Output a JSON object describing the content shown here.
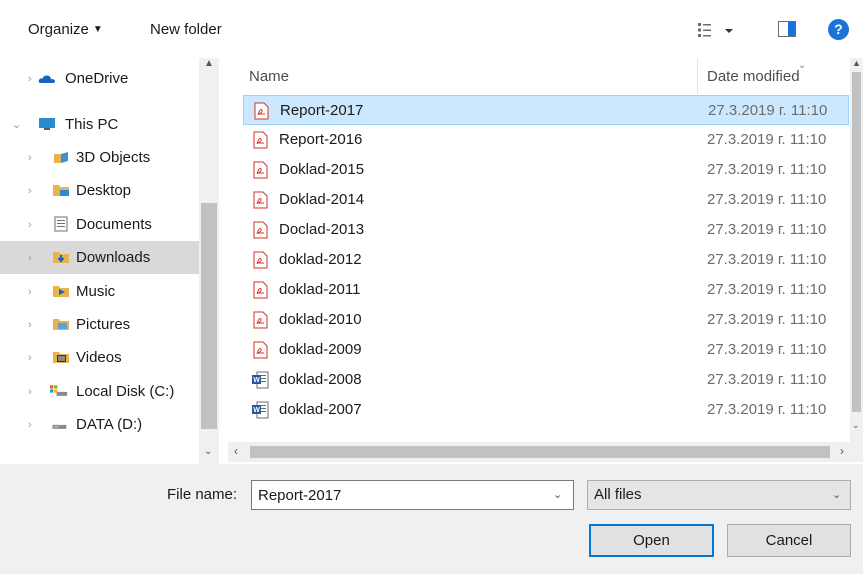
{
  "toolbar": {
    "organize_label": "Organize",
    "new_folder_label": "New folder",
    "help_label": "?"
  },
  "nav": {
    "items": [
      {
        "label": "OneDrive",
        "icon": "onedrive-icon"
      },
      {
        "label": "This PC",
        "icon": "pc-icon"
      },
      {
        "label": "3D Objects",
        "icon": "3d-objects-icon"
      },
      {
        "label": "Desktop",
        "icon": "desktop-icon"
      },
      {
        "label": "Documents",
        "icon": "documents-icon"
      },
      {
        "label": "Downloads",
        "icon": "downloads-icon"
      },
      {
        "label": "Music",
        "icon": "music-icon"
      },
      {
        "label": "Pictures",
        "icon": "pictures-icon"
      },
      {
        "label": "Videos",
        "icon": "videos-icon"
      },
      {
        "label": "Local Disk (C:)",
        "icon": "local-disk-icon"
      },
      {
        "label": "DATA (D:)",
        "icon": "drive-icon"
      }
    ],
    "selected": "Downloads"
  },
  "list": {
    "columns": {
      "name": "Name",
      "date": "Date modified"
    },
    "rows": [
      {
        "name": "Report-2017",
        "date": "27.3.2019 г. 11:10",
        "type": "pdf"
      },
      {
        "name": "Report-2016",
        "date": "27.3.2019 г. 11:10",
        "type": "pdf"
      },
      {
        "name": "Doklad-2015",
        "date": "27.3.2019 г. 11:10",
        "type": "pdf"
      },
      {
        "name": "Doklad-2014",
        "date": "27.3.2019 г. 11:10",
        "type": "pdf"
      },
      {
        "name": "Doclad-2013",
        "date": "27.3.2019 г. 11:10",
        "type": "pdf"
      },
      {
        "name": "doklad-2012",
        "date": "27.3.2019 г. 11:10",
        "type": "pdf"
      },
      {
        "name": "doklad-2011",
        "date": "27.3.2019 г. 11:10",
        "type": "pdf"
      },
      {
        "name": "doklad-2010",
        "date": "27.3.2019 г. 11:10",
        "type": "pdf"
      },
      {
        "name": "doklad-2009",
        "date": "27.3.2019 г. 11:10",
        "type": "pdf"
      },
      {
        "name": "doklad-2008",
        "date": "27.3.2019 г. 11:10",
        "type": "word"
      },
      {
        "name": "doklad-2007",
        "date": "27.3.2019 г. 11:10",
        "type": "word"
      }
    ],
    "selected": "Report-2017"
  },
  "bottom": {
    "file_name_label": "File name:",
    "file_name_value": "Report-2017",
    "file_type_value": "All files",
    "open_label": "Open",
    "cancel_label": "Cancel"
  },
  "colors": {
    "selected_row": "#cce8ff",
    "selected_row_border": "#99d1ff",
    "nav_selected": "#d9d9d9",
    "accent": "#0078d7",
    "pdf_red": "#d93025",
    "word_blue": "#2b579a"
  }
}
